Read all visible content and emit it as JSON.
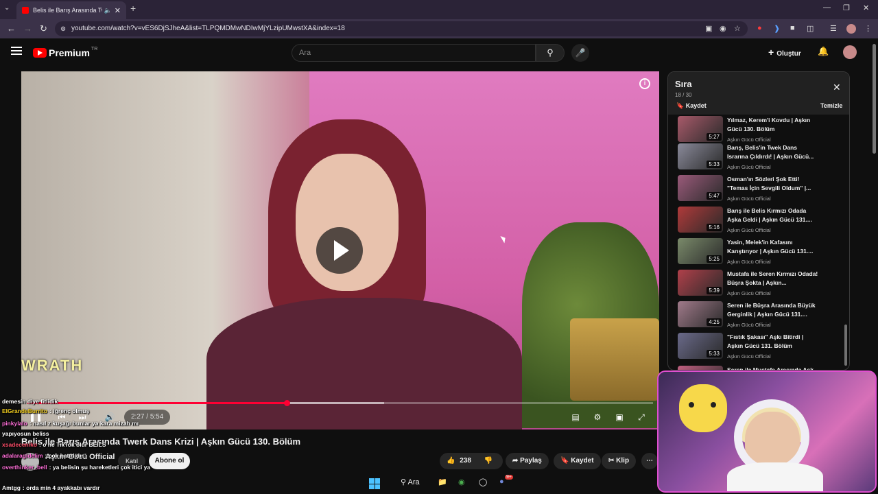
{
  "browser": {
    "tab_title": "Belis ile Barış Arasında Twerk Dans Krizi",
    "url": "youtube.com/watch?v=vES6DjSJheA&list=TLPQMDMwNDIwMjYLzipUMwstXA&index=18"
  },
  "youtube": {
    "brand": "Premium",
    "region": "TR",
    "search_placeholder": "Ara",
    "create_label": "Oluştur"
  },
  "player": {
    "time_current": "2:27",
    "time_separator": "/",
    "time_total": "5:54",
    "progress_fraction": 0.415,
    "buffered_fraction": 0.57,
    "watermark_text": "WRATH"
  },
  "video": {
    "title": "Belis ile Barış Arasında Twerk Dans Krizi | Aşkın Gücü 130. Bölüm",
    "channel": "Aşkın Gücü Official",
    "join_label": "Katıl",
    "subscribe_label": "Abone ol",
    "likes": "238",
    "share_label": "Paylaş",
    "save_label": "Kaydet",
    "clip_label": "Klip"
  },
  "queue": {
    "title": "Sıra",
    "position": "18 / 30",
    "save_label": "Kaydet",
    "clear_label": "Temizle",
    "items": [
      {
        "title": "Yılmaz, Kerem'i Kovdu | Aşkın Gücü 130. Bölüm",
        "channel": "Aşkın Gücü Official",
        "duration": "5:27",
        "color": "#a85a6a"
      },
      {
        "title": "Barış, Belis'in Twek Dans Israrına Çıldırdı! | Aşkın Gücü...",
        "channel": "Aşkın Gücü Official",
        "duration": "5:33",
        "color": "#8a8a9a"
      },
      {
        "title": "Osman'ın Sözleri Şok Etti! \"Temas İçin Sevgili Oldum\" |...",
        "channel": "Aşkın Gücü Official",
        "duration": "5:47",
        "color": "#9a5a7a"
      },
      {
        "title": "Barış ile Belis Kırmızı Odada Aşka Geldi | Aşkın Gücü 131....",
        "channel": "Aşkın Gücü Official",
        "duration": "5:16",
        "color": "#b03a3a"
      },
      {
        "title": "Yasin, Melek'in Kafasını Karıştırıyor | Aşkın Gücü 131....",
        "channel": "Aşkın Gücü Official",
        "duration": "5:25",
        "color": "#7a8a6a"
      },
      {
        "title": "Mustafa ile Seren Kırmızı Odada! Büşra Şokta | Aşkın...",
        "channel": "Aşkın Gücü Official",
        "duration": "5:39",
        "color": "#b0404a"
      },
      {
        "title": "Seren ile Büşra Arasında Büyük Gerginlik | Aşkın Gücü 131....",
        "channel": "Aşkın Gücü Official",
        "duration": "4:25",
        "color": "#a07a8a"
      },
      {
        "title": "\"Fıstık Şakası\" Aşkı Bitirdi | Aşkın Gücü 131. Bölüm",
        "channel": "Aşkın Gücü Official",
        "duration": "5:33",
        "color": "#6a6a8a"
      },
      {
        "title": "Seren ile Mustafa Arasında Aşk...",
        "channel": "Aşkın Gücü Official",
        "duration": "",
        "color": "#c06080"
      }
    ]
  },
  "chat": [
    {
      "user": "",
      "message": "demesin diye fitlidik",
      "color": "#ffffff"
    },
    {
      "user": "EIGrandeBurrito",
      "message": "iğrenç olmuş",
      "color": "#f5d020"
    },
    {
      "user": "pinkylalo",
      "message": "nasıl z kuşağı bunlar ya kara mizah mı",
      "color": "#ff6fd8"
    },
    {
      "user": "",
      "message": "yapıyosun beliss",
      "color": "#ffffff"
    },
    {
      "user": "xsadeceniko",
      "message": "o ne TikTok olur BEİLS",
      "color": "#ff4f6a"
    },
    {
      "user": "adalaragidelim",
      "message": "cok hatırlıdır",
      "color": "#ff6fd8"
    },
    {
      "user": "overthinker_bell",
      "message": "ya belisin şu hareketleri çok itici ya",
      "color": "#ff6fd8"
    },
    {
      "user": "Amtgg",
      "message": "orda min 4 ayakkabı vardır",
      "color": "#ffffff"
    }
  ],
  "taskbar": {
    "search_label": "Ara",
    "discord_badge": "9+"
  }
}
